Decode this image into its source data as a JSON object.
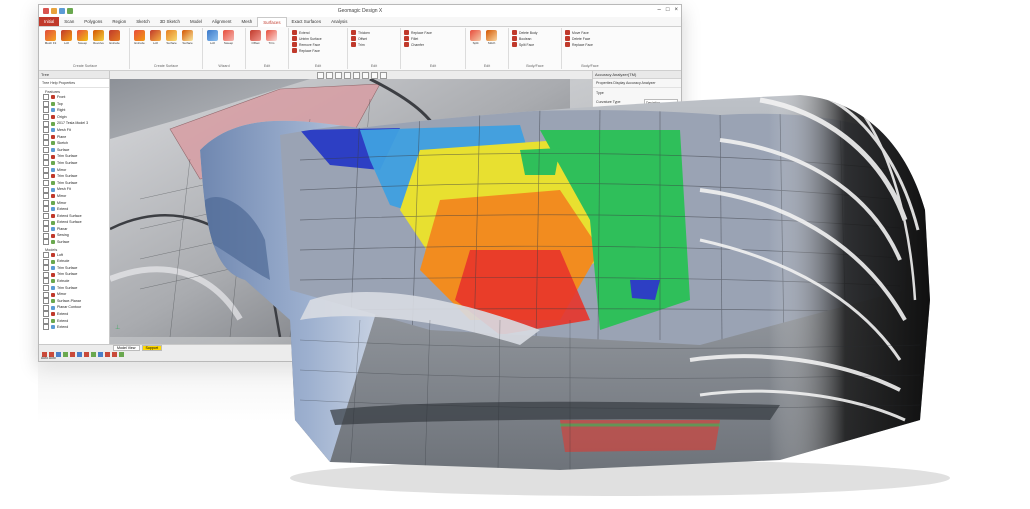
{
  "window": {
    "title": "Geomagic Design X",
    "controls": [
      "–",
      "□",
      "×"
    ]
  },
  "ribbon": {
    "tabs": [
      "Initial",
      "Scan",
      "Polygons",
      "Region",
      "Sketch",
      "3D Sketch",
      "Model",
      "Alignment",
      "Mesh",
      "Surfaces",
      "Exact Surfaces",
      "Analysis"
    ],
    "active_tab": "Surfaces",
    "groups": [
      {
        "label": "Create Surface",
        "buttons": [
          "Mesh Fit",
          "Loft",
          "Sweep",
          "Revolve",
          "Extrude"
        ]
      },
      {
        "label": "Create Surface",
        "buttons": [
          "Extrude",
          "Loft",
          "Surface",
          "Surface"
        ]
      },
      {
        "label": "Wizard",
        "buttons": [
          "Loft",
          "Sweep"
        ]
      },
      {
        "label": "Edit",
        "buttons": [
          "Offset",
          "Trim"
        ]
      },
      {
        "label": "Edit",
        "items": [
          "Extend",
          "Untrim Surface",
          "Remove Face",
          "Replace Face"
        ]
      },
      {
        "label": "Edit",
        "items": [
          "Thicken",
          "Offset",
          "Trim"
        ]
      },
      {
        "label": "Edit",
        "items": [
          "Replace Face",
          "Fillet",
          "Chamfer"
        ]
      },
      {
        "label": "Edit",
        "buttons": [
          "Split",
          "Stitch"
        ]
      },
      {
        "label": "Body/Face",
        "items": [
          "Delete Body",
          "Boolean",
          "Split Face"
        ]
      },
      {
        "label": "Body/Face",
        "items": [
          "Move Face",
          "Delete Face",
          "Replace Face"
        ]
      }
    ]
  },
  "tree_panel": {
    "title": "Tree",
    "toolbar": "Tree  Help  Properties",
    "sections": [
      {
        "name": "Features",
        "rows": [
          "Front",
          "Top",
          "Right",
          "Origin",
          "2017 Tesla Model 3",
          "Mesh Fit",
          "Plane",
          "Sketch",
          "Surface",
          "Trim Surface",
          "Trim Surface",
          "Mirror",
          "Trim Surface",
          "Trim Surface",
          "Mesh Fit",
          "Mirror",
          "Mirror",
          "Extend",
          "Extend Surface",
          "Extend Surface",
          "Planar",
          "Sewing",
          "Surface"
        ]
      },
      {
        "name": "Models",
        "rows": [
          "Loft",
          "Extrude",
          "Trim Surface",
          "Trim Surface",
          "Extrude",
          "Trim Surface",
          "Mirror",
          "Surface-Planar",
          "Planar Contour",
          "Extend",
          "Extend",
          "Extend"
        ]
      }
    ]
  },
  "properties_panel": {
    "title": "Accuracy Analyzer(TM)",
    "toolbar": "Properties  Display  Accuracy Analyzer",
    "rows": [
      {
        "label": "Type",
        "value": ""
      },
      {
        "label": "Curvature Type",
        "value": "Deviation"
      },
      {
        "label": "Tolerance",
        "value": ""
      },
      {
        "label": "Range",
        "value": ""
      },
      {
        "label": "Color Bar",
        "value": "Mean"
      },
      {
        "label": "Curvature Limits",
        "value": "0.1"
      },
      {
        "label": "Continuity",
        "value": "Tangent"
      }
    ]
  },
  "view_tabs": [
    "Model View",
    "Support"
  ],
  "active_view_tab": "Support",
  "status_left": "Auto  Auto",
  "viewport": {
    "colormap": [
      "#2d3fc4",
      "#3fa0e0",
      "#2fbf5a",
      "#e8e030",
      "#f28c1f",
      "#e8342a"
    ]
  }
}
